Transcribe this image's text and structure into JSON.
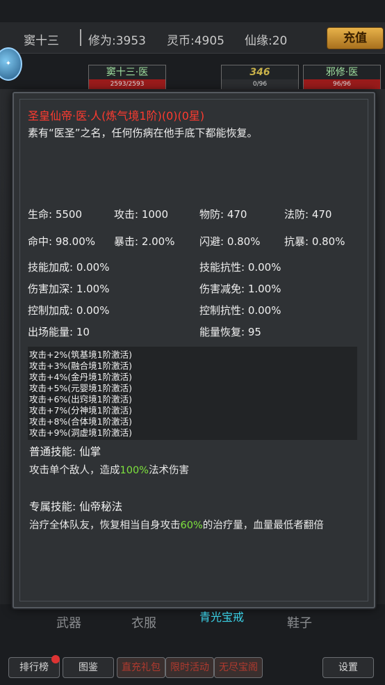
{
  "topbar": {
    "name": "窦十三",
    "cultivation": "修为:3953",
    "spirit_coin": "灵币:4905",
    "fate": "仙缘:20",
    "recharge": "充值"
  },
  "badge": {
    "icon": "event-badge-icon"
  },
  "team": [
    {
      "name": "窦十三·医",
      "hp": "2593/2593"
    },
    {
      "name": "346",
      "hp": "0/96"
    },
    {
      "name": "邪修·医",
      "hp": "96/96"
    }
  ],
  "hero": {
    "title": "圣皇仙帝·医·人(炼气境1阶)(0)(0星)",
    "desc": "素有“医圣”之名，任何伤病在他手底下都能恢复。",
    "stats_row1": [
      "生命: 5500",
      "攻击: 1000",
      "物防: 470",
      "法防: 470"
    ],
    "stats_row2": [
      "命中: 98.00%",
      "暴击: 2.00%",
      "闪避: 0.80%",
      "抗暴: 0.80%"
    ],
    "stats_pairs": [
      [
        "技能加成: 0.00%",
        "技能抗性: 0.00%"
      ],
      [
        "伤害加深: 1.00%",
        "伤害减免: 1.00%"
      ],
      [
        "控制加成: 0.00%",
        "控制抗性: 0.00%"
      ],
      [
        "出场能量: 10",
        "能量恢复: 95"
      ]
    ],
    "bonuses": [
      "攻击+2%(筑基境1阶激活)",
      "攻击+3%(融合境1阶激活)",
      "攻击+4%(金丹境1阶激活)",
      "攻击+5%(元婴境1阶激活)",
      "攻击+6%(出窍境1阶激活)",
      "攻击+7%(分神境1阶激活)",
      "攻击+8%(合体境1阶激活)",
      "攻击+9%(洞虚境1阶激活)"
    ],
    "normal_skill": {
      "title": "普通技能: 仙掌",
      "pre": "攻击单个敌人，造成",
      "hl": "100%",
      "post": "法术伤害"
    },
    "special_skill": {
      "title": "专属技能: 仙帝秘法",
      "pre": "治疗全体队友，恢复相当自身攻击",
      "hl": "60%",
      "post": "的治疗量，血量最低者翻倍"
    },
    "highlight_color": "#7ee33d",
    "title_color": "#ff3b30"
  },
  "equipment": [
    "武器",
    "衣服",
    "青光宝戒",
    "鞋子"
  ],
  "bottom_bar": [
    "排行榜",
    "图鉴",
    "直充礼包",
    "限时活动",
    "无尽宝阁",
    "设置"
  ]
}
